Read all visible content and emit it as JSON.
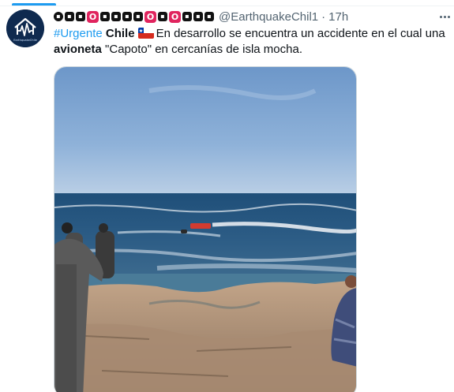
{
  "tweet": {
    "display_name_glyphs": [
      "▪",
      "▪",
      "▪",
      "O",
      "▪",
      "▪",
      "▪",
      "▪",
      "O",
      "▪",
      "O",
      "▪",
      "▪",
      "▪"
    ],
    "handle": "@EarthquakeChil1",
    "separator": "·",
    "time": "17h",
    "hashtag": "#Urgente",
    "country": "Chile",
    "text_part1": "En desarrollo se encuentra un accidente en el cual una",
    "bold_word": "avioneta",
    "text_part2": "\"Capoto\" en cercanías de isla mocha.",
    "avatar_label": "EarthquakeChile"
  },
  "icons": {
    "avatar": "seismograph-house-logo-icon",
    "flag": "chile-flag-icon",
    "more": "more-options-icon"
  },
  "colors": {
    "accent": "#1d9bf0",
    "secondary_text": "#536471",
    "avatar_bg": "#0f2a4f"
  }
}
